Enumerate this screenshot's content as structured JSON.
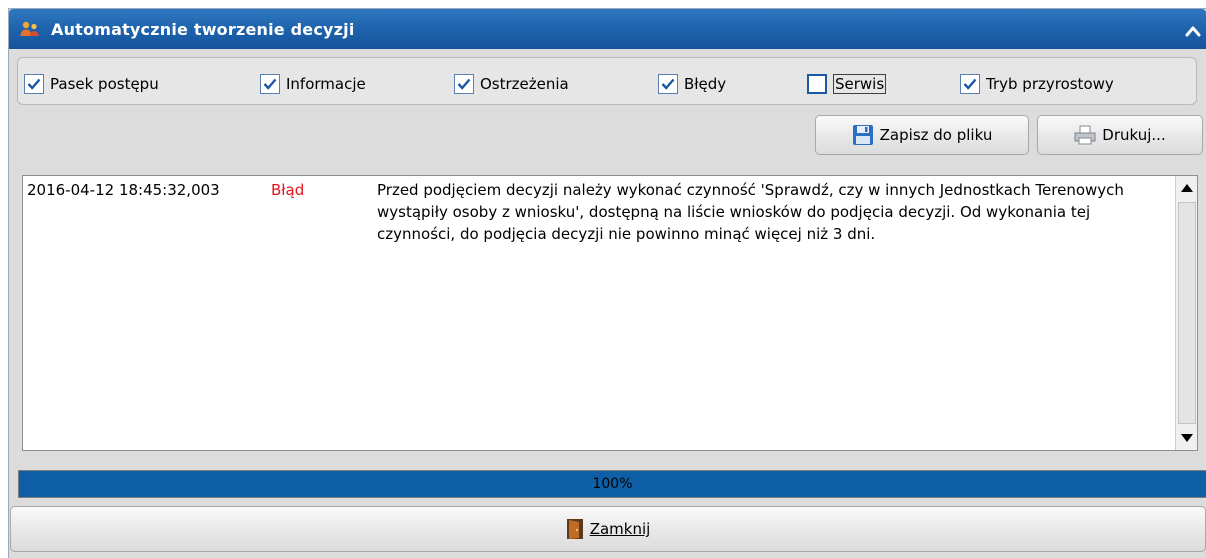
{
  "window": {
    "title": "Automatycznie tworzenie decyzji"
  },
  "filters": [
    {
      "label": "Pasek postępu",
      "checked": true
    },
    {
      "label": "Informacje",
      "checked": true
    },
    {
      "label": "Ostrzeżenia",
      "checked": true
    },
    {
      "label": "Błędy",
      "checked": true
    },
    {
      "label": "Serwis",
      "checked": false
    },
    {
      "label": "Tryb przyrostowy",
      "checked": true
    }
  ],
  "toolbar": {
    "save_label": "Zapisz do pliku",
    "print_label": "Drukuj..."
  },
  "log": {
    "entries": [
      {
        "timestamp": "2016-04-12 18:45:32,003",
        "level": "Błąd",
        "message": "Przed podjęciem decyzji należy wykonać czynność 'Sprawdź, czy w innych Jednostkach Terenowych wystąpiły osoby z wniosku', dostępną na liście wniosków do podjęcia decyzji. Od wykonania tej czynności, do podjęcia decyzji nie powinno minąć więcej niż 3 dni."
      }
    ]
  },
  "progress": {
    "value": 1.0,
    "label": "100%"
  },
  "footer": {
    "close_label": "Zamknij"
  },
  "colors": {
    "title_bar": "#1e63ad",
    "progress_fill": "#0f5fa6",
    "error_text": "#e8141d"
  }
}
